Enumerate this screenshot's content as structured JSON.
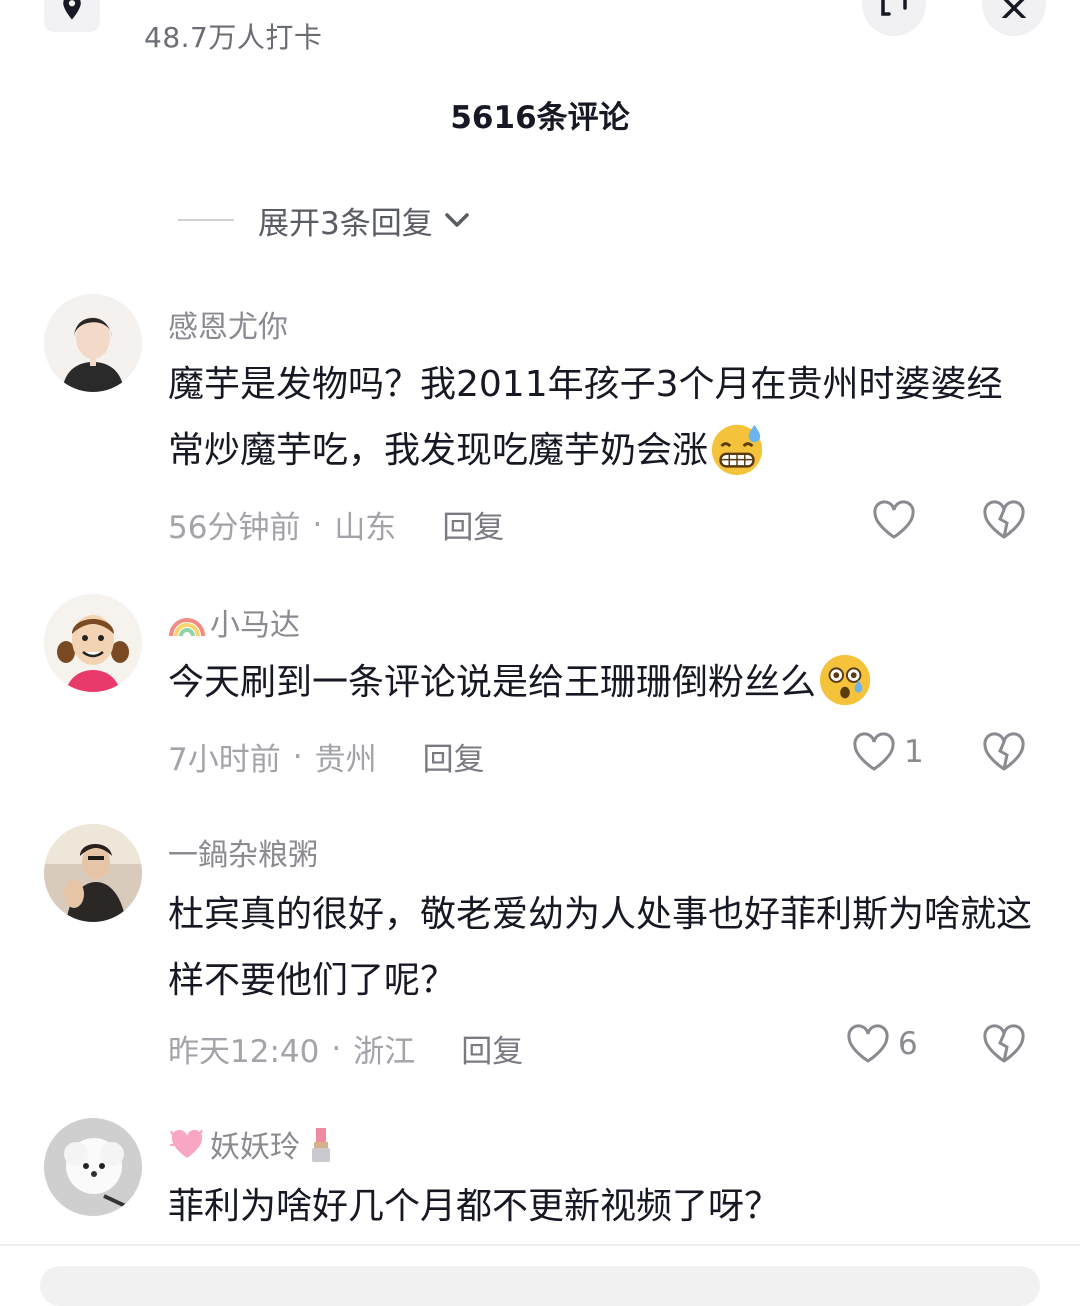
{
  "header": {
    "checkin_text": "48.7万人打卡",
    "comment_count": "5616条评论"
  },
  "thread": {
    "expand_replies_label": "展开3条回复"
  },
  "comments": [
    {
      "nickname": "感恩尤你",
      "text": "魔芋是发物吗？我2011年孩子3个月在贵州时婆婆经常炒魔芋吃，我发现吃魔芋奶会涨",
      "time": "56分钟前",
      "location": "山东",
      "reply_label": "回复",
      "like_count": ""
    },
    {
      "nickname": "小马达",
      "text": "今天刷到一条评论说是给王珊珊倒粉丝么",
      "time": "7小时前",
      "location": "贵州",
      "reply_label": "回复",
      "like_count": "1"
    },
    {
      "nickname": "一鍋杂粮粥",
      "text": "杜宾真的很好，敬老爱幼为人处事也好菲利斯为啥就这样不要他们了呢？",
      "time": "昨天12:40",
      "location": "浙江",
      "reply_label": "回复",
      "like_count": "6"
    },
    {
      "nickname": "妖妖玲",
      "text": "菲利为啥好几个月都不更新视频了呀？",
      "time": "",
      "location": "",
      "reply_label": "",
      "like_count": ""
    }
  ],
  "colors": {
    "text_primary": "#161823",
    "text_secondary": "#8a8b91",
    "background": "#ffffff"
  }
}
